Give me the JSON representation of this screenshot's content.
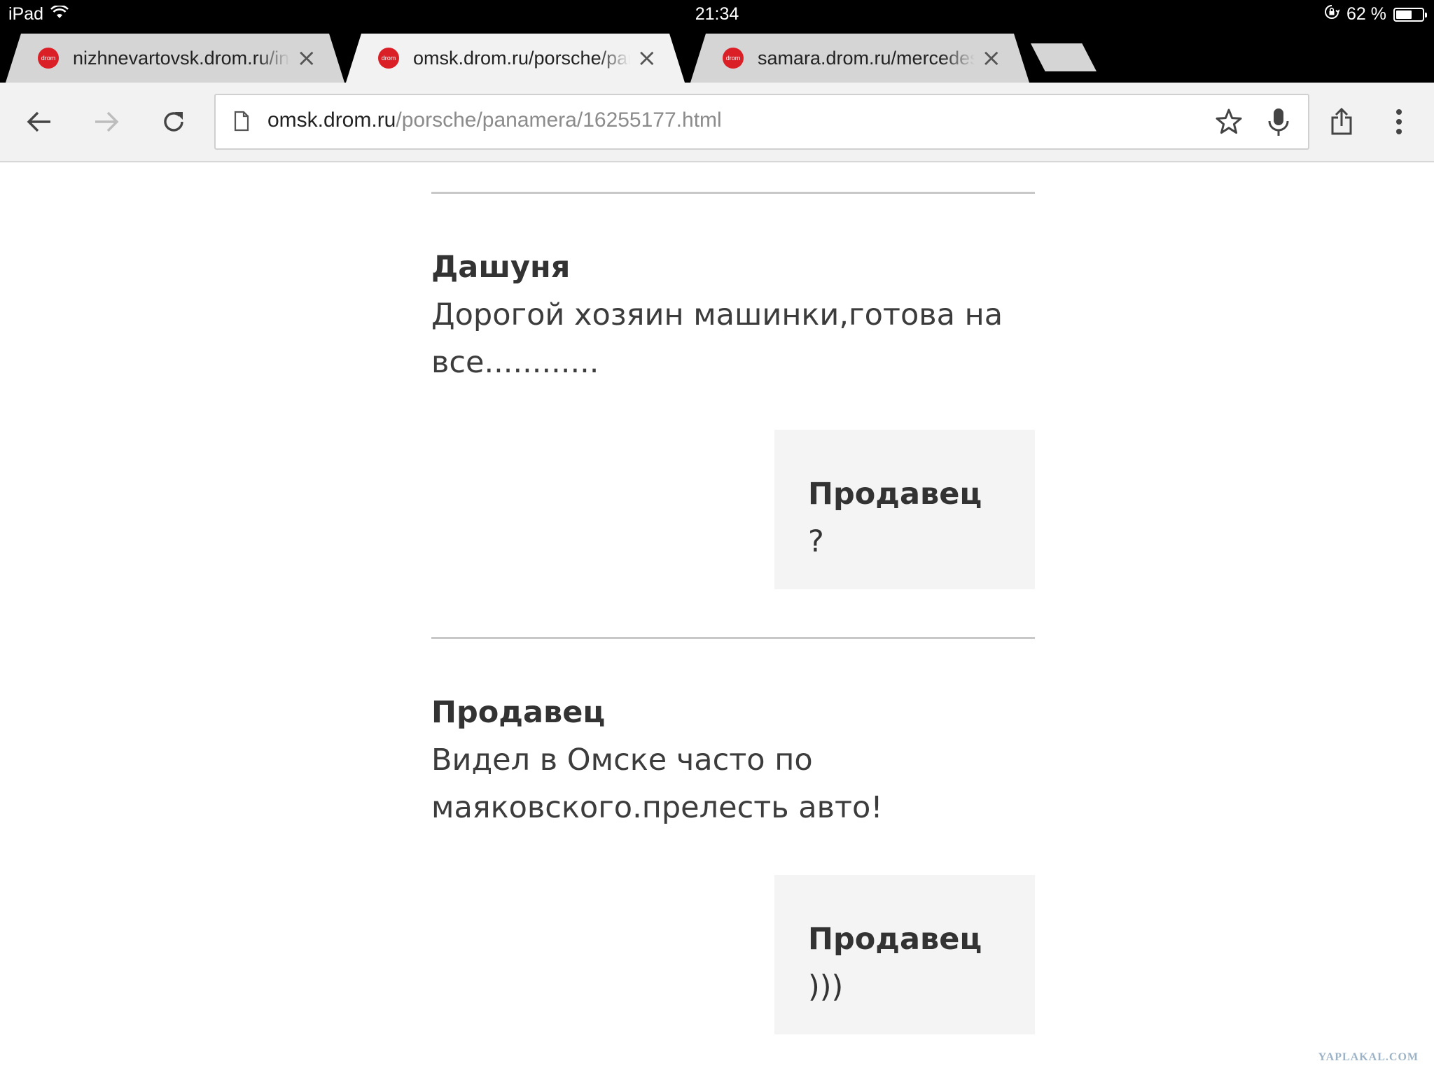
{
  "status_bar": {
    "device": "iPad",
    "time": "21:34",
    "battery_text": "62 %",
    "battery_level": 0.62
  },
  "tabs": [
    {
      "title": "nizhnevartovsk.drom.ru/infiniti",
      "favicon": "drom-logo-icon",
      "active": false
    },
    {
      "title": "omsk.drom.ru/porsche/panamera",
      "favicon": "drom-logo-icon",
      "active": true
    },
    {
      "title": "samara.drom.ru/mercedes-benz",
      "favicon": "drom-logo-icon",
      "active": false
    }
  ],
  "toolbar": {
    "url_host": "omsk.drom.ru",
    "url_path": "/porsche/panamera/16255177.html"
  },
  "comments": [
    {
      "author": "Дашуня",
      "text_lines": [
        "Дорогой хозяин машинки,готова на",
        "все............"
      ],
      "reply": {
        "author": "Продавец",
        "text": "?"
      }
    },
    {
      "author": "Продавец",
      "text_lines": [
        "Видел в Омске часто по",
        "маяковского.прелесть авто!"
      ],
      "reply": {
        "author": "Продавец",
        "text": ")))"
      }
    }
  ],
  "watermark": "YAPLAKAL.COM",
  "colors": {
    "accent_favicon": "#db1f26",
    "toolbar_bg": "#f2f2f2",
    "reply_bg": "#f4f4f4"
  }
}
